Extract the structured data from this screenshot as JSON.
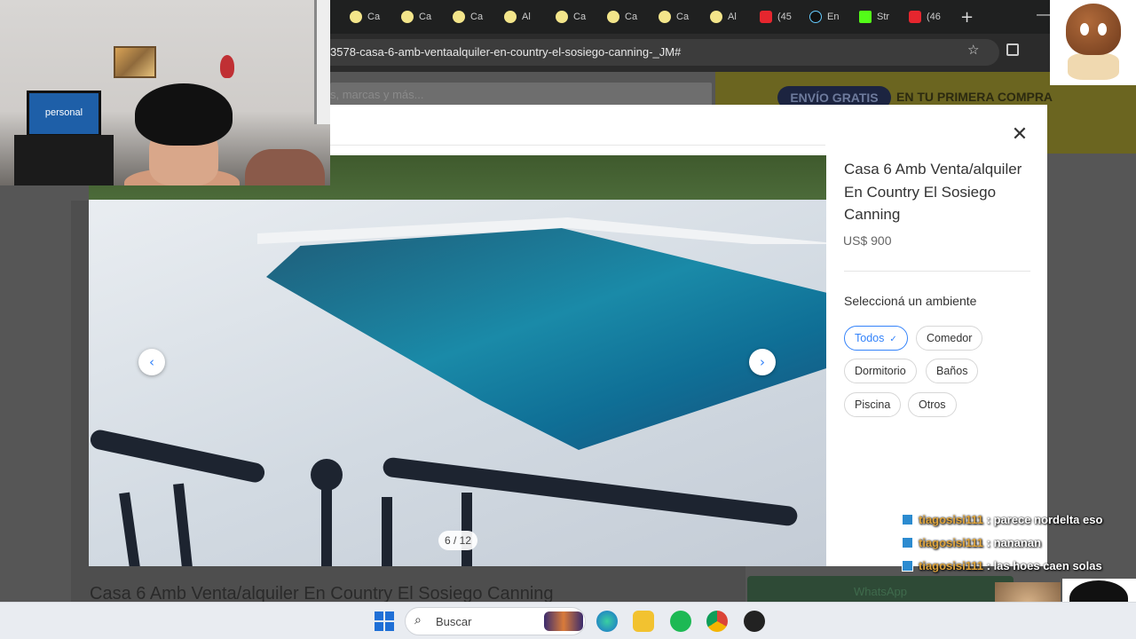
{
  "browser": {
    "tabs": [
      {
        "label": "Ca",
        "icon": "mercadolibre-icon"
      },
      {
        "label": "Ca",
        "icon": "mercadolibre-icon"
      },
      {
        "label": "Ca",
        "icon": "mercadolibre-icon"
      },
      {
        "label": "Al",
        "icon": "mercadolibre-icon"
      },
      {
        "label": "Ca",
        "icon": "mercadolibre-icon"
      },
      {
        "label": "Ca",
        "icon": "mercadolibre-icon"
      },
      {
        "label": "Ca",
        "icon": "mercadolibre-icon"
      },
      {
        "label": "Al",
        "icon": "mercadolibre-icon"
      },
      {
        "label": "(45",
        "icon": "youtube-icon"
      },
      {
        "label": "En",
        "icon": "tiktok-icon"
      },
      {
        "label": "Str",
        "icon": "kick-icon"
      },
      {
        "label": "(46",
        "icon": "youtube-icon"
      }
    ],
    "new_tab": "+",
    "url": "3578-casa-6-amb-ventaalquiler-en-country-el-sosiego-canning-_JM#"
  },
  "page": {
    "search_placeholder": "s, marcas y más...",
    "banner_pill": "ENVÍO GRATIS",
    "banner_text_pre": "EN TU ",
    "banner_text_bold": "PRIMERA COMPRA",
    "title": "Casa 6 Amb Venta/alquiler En Country El Sosiego Canning",
    "whatsapp": "WhatsApp"
  },
  "gallery": {
    "counter": "6 / 12",
    "prev": "‹",
    "next": "›"
  },
  "panel": {
    "title": "Casa 6 Amb Venta/alquiler En Country El Sosiego Canning",
    "price": "US$ 900",
    "section_label": "Seleccioná un ambiente",
    "chips": [
      {
        "label": "Todos",
        "selected": true
      },
      {
        "label": "Comedor",
        "selected": false
      },
      {
        "label": "Dormitorio",
        "selected": false
      },
      {
        "label": "Baños",
        "selected": false
      },
      {
        "label": "Piscina",
        "selected": false
      },
      {
        "label": "Otros",
        "selected": false
      }
    ],
    "close": "✕"
  },
  "stream": {
    "tv_text": "personal",
    "chat": [
      {
        "user": "tiagosisi111",
        "message": "parece nordelta eso"
      },
      {
        "user": "tiagosisi111",
        "message": "nananan"
      },
      {
        "user": "tiagosisi111",
        "message": "las hoes caen solas"
      }
    ],
    "chat_separator": " : "
  },
  "taskbar": {
    "search_label": "Buscar"
  },
  "colors": {
    "accent": "#3483fa",
    "chat_user": "#e0a53c"
  }
}
